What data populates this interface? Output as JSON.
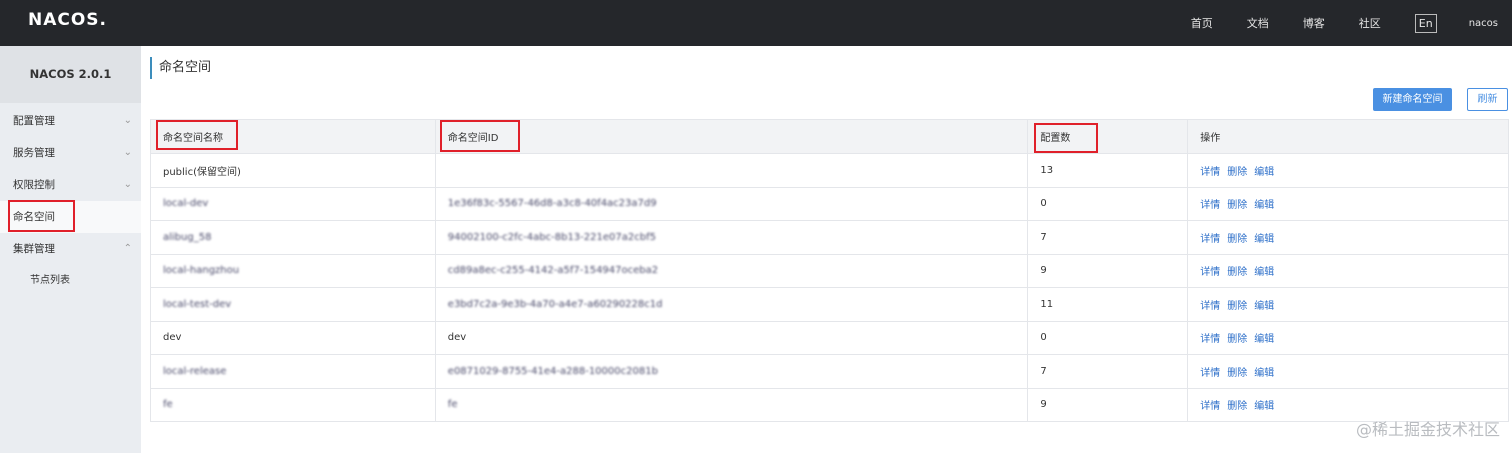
{
  "header": {
    "logo": "NACOS.",
    "nav": [
      "首页",
      "文档",
      "博客",
      "社区"
    ],
    "lang": "En",
    "user": "nacos"
  },
  "sidebar": {
    "version": "NACOS 2.0.1",
    "items": [
      {
        "label": "配置管理",
        "chevron": "chevron-down-icon"
      },
      {
        "label": "服务管理",
        "chevron": "chevron-down-icon"
      },
      {
        "label": "权限控制",
        "chevron": "chevron-down-icon"
      },
      {
        "label": "命名空间",
        "chevron": ""
      },
      {
        "label": "集群管理",
        "chevron": "chevron-up-icon"
      },
      {
        "label": "节点列表",
        "chevron": ""
      }
    ]
  },
  "main": {
    "title": "命名空间",
    "new_button": "新建命名空间",
    "refresh_button": "刷新",
    "columns": [
      "命名空间名称",
      "命名空间ID",
      "配置数",
      "操作"
    ],
    "actions": [
      "详情",
      "删除",
      "编辑"
    ],
    "rows": [
      {
        "name": "public(保留空间)",
        "id": "",
        "count": "13"
      },
      {
        "name": "local-dev",
        "id": "1e36f83c-5567-46d8-a3c8-40f4ac23a7d9",
        "count": "0"
      },
      {
        "name": "alibug_58",
        "id": "94002100-c2fc-4abc-8b13-221e07a2cbf5",
        "count": "7"
      },
      {
        "name": "local-hangzhou",
        "id": "cd89a8ec-c255-4142-a5f7-154947oceba2",
        "count": "9"
      },
      {
        "name": "local-test-dev",
        "id": "e3bd7c2a-9e3b-4a70-a4e7-a60290228c1d",
        "count": "11"
      },
      {
        "name": "dev",
        "id": "dev",
        "count": "0"
      },
      {
        "name": "local-release",
        "id": "e0871029-8755-41e4-a288-10000c2081b",
        "count": "7"
      },
      {
        "name": "fe",
        "id": "fe",
        "count": "9"
      }
    ]
  },
  "watermark": "@稀土掘金技术社区",
  "colors": {
    "accent": "#4a90e2",
    "topbar": "#25272b",
    "annotation": "#e0202a"
  }
}
